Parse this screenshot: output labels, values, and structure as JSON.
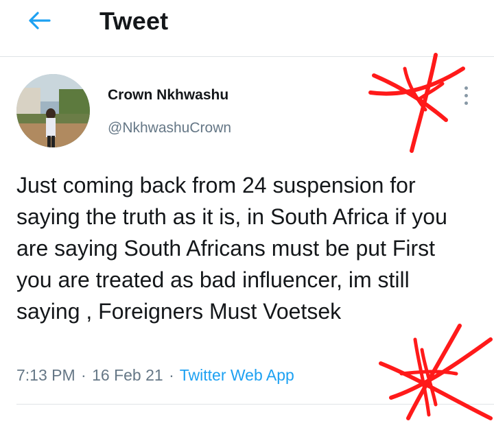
{
  "header": {
    "title": "Tweet",
    "back_icon": "arrow-left-icon"
  },
  "tweet": {
    "author_name": "Crown Nkhwashu",
    "author_handle": "@NkhwashuCrown",
    "more_icon": "more-vertical-icon",
    "text": "Just coming back from 24 suspension for saying the truth as it is, in South Africa if you are saying South Africans must be put First you are treated as bad influencer, im still saying , Foreigners Must Voetsek",
    "time": "7:13 PM",
    "date": "16 Feb 21",
    "source": "Twitter Web App"
  },
  "colors": {
    "accent": "#1da1f2",
    "secondary_text": "#657786",
    "divider": "#dfe3e6",
    "scribble": "#ff1a1a"
  }
}
